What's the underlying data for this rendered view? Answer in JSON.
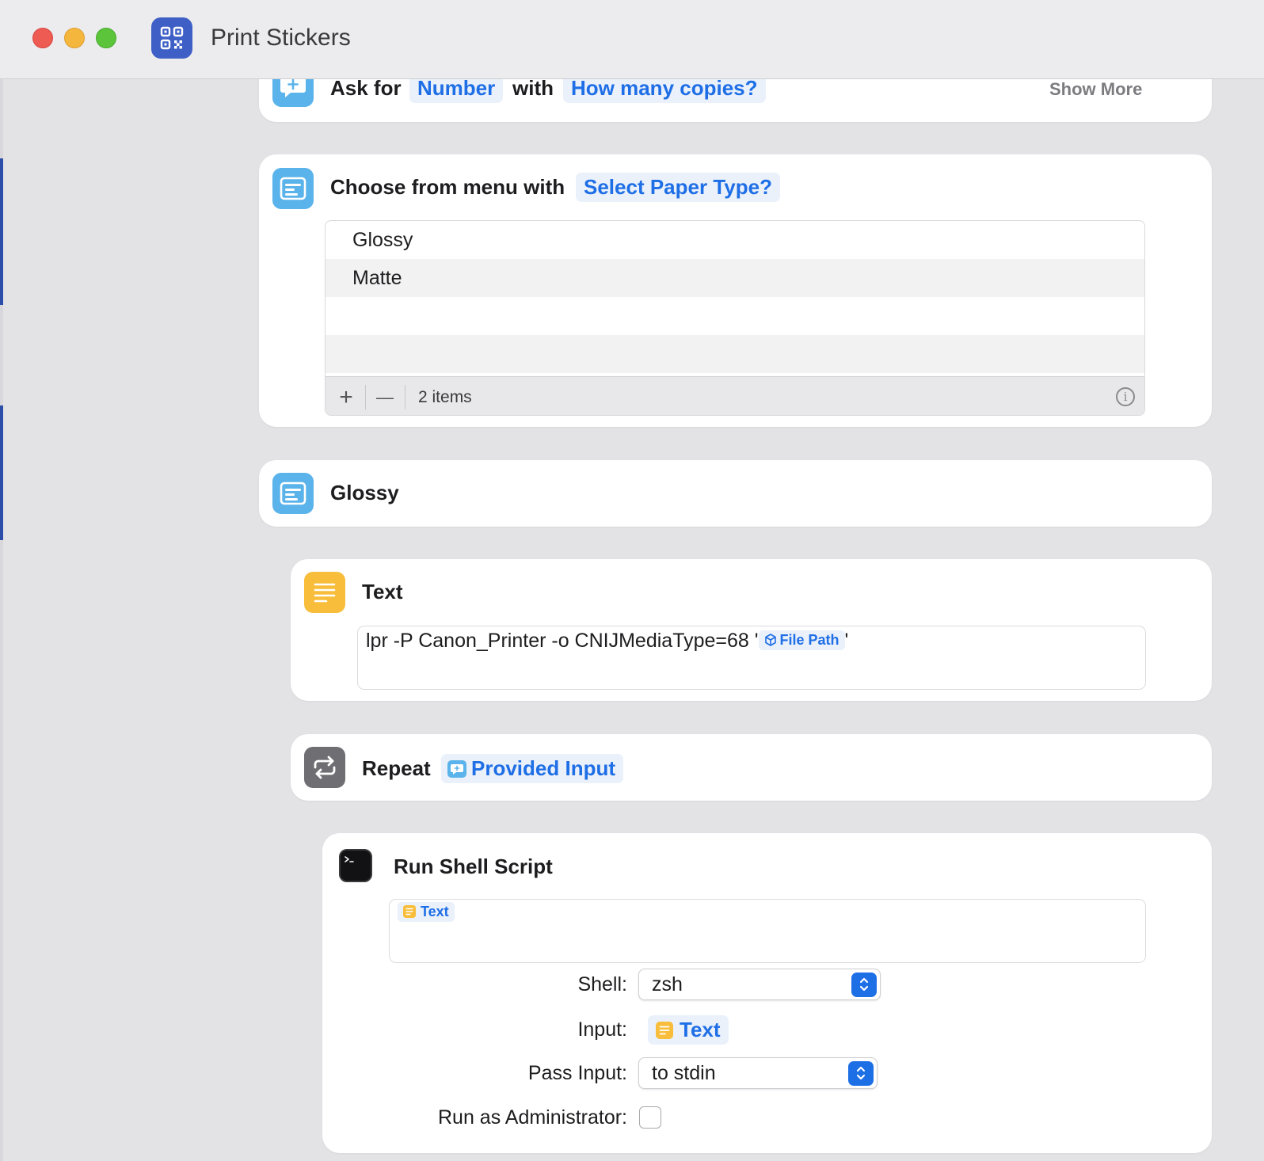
{
  "window": {
    "title": "Print Stickers",
    "app_icon": "qrcode-icon"
  },
  "actions": {
    "ask_for": {
      "label": "Ask for",
      "type_token": "Number",
      "with_label": "with",
      "prompt_token": "How many copies?",
      "show_more": "Show More",
      "icon": "ask-bubble-icon"
    },
    "choose_menu": {
      "label": "Choose from menu with",
      "prompt_token": "Select Paper Type?",
      "icon": "menu-icon",
      "items": [
        "Glossy",
        "Matte"
      ],
      "count_label": "2 items",
      "add": "+",
      "remove": "—",
      "info": "i"
    },
    "glossy_case": {
      "label": "Glossy",
      "icon": "menu-icon"
    },
    "text_action": {
      "label": "Text",
      "icon": "text-lines-icon",
      "content_prefix": "lpr -P Canon_Printer -o CNIJMediaType=68 '",
      "variable_token": "File Path",
      "content_suffix": "'"
    },
    "repeat": {
      "label": "Repeat",
      "input_token": "Provided Input",
      "icon": "repeat-icon"
    },
    "shell": {
      "label": "Run Shell Script",
      "icon": "terminal-icon",
      "script_token": "Text",
      "shell_label": "Shell:",
      "shell_value": "zsh",
      "input_label": "Input:",
      "input_value": "Text",
      "pass_input_label": "Pass Input:",
      "pass_input_value": "to stdin",
      "admin_label": "Run as Administrator:",
      "admin_checked": false
    }
  },
  "colors": {
    "accent": "#1e6ee6",
    "action_blue": "#5ab3ea",
    "action_yellow": "#f8bd3a",
    "action_gray": "#6f6f73"
  }
}
